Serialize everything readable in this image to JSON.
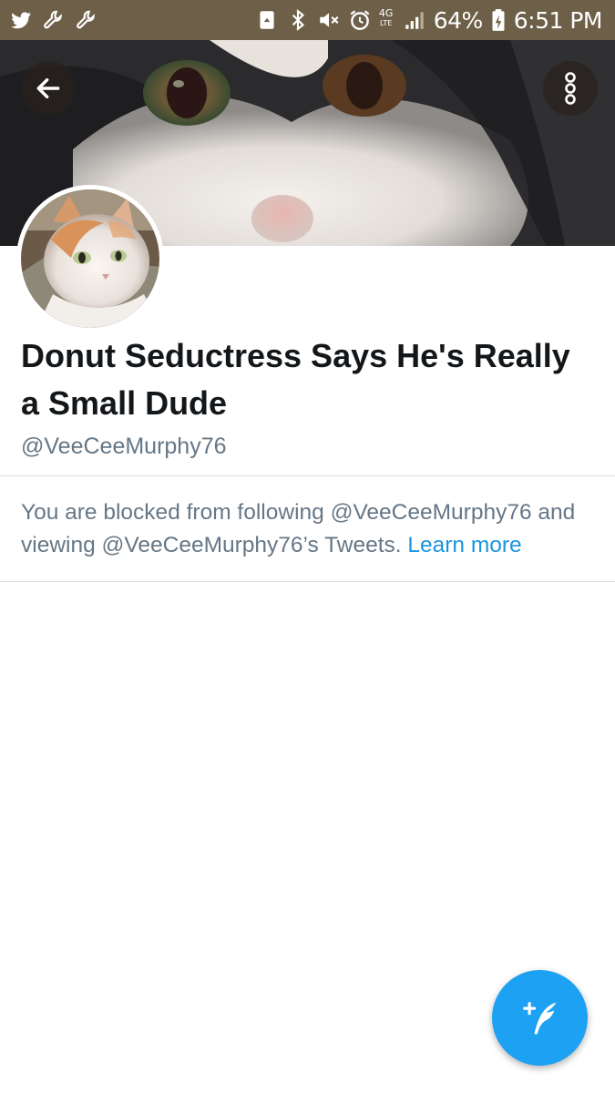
{
  "status_bar": {
    "battery": "64%",
    "time": "6:51 PM",
    "network_top": "4G",
    "network_bottom": "LTE",
    "left_icons": [
      "twitter-bird-icon",
      "wrench-icon",
      "wrench-icon"
    ],
    "right_icons": [
      "recycle-icon",
      "bluetooth-icon",
      "vibrate-mute-icon",
      "alarm-icon",
      "signal-icon",
      "battery-charging-icon"
    ],
    "background_color": "#6e6048"
  },
  "header": {
    "back_icon": "arrow-left-icon",
    "more_icon": "more-vertical-icon"
  },
  "profile": {
    "display_name": "Donut Seductress Says He's Really a Small Dude",
    "handle": "@VeeCeeMurphy76"
  },
  "blocked": {
    "message": "You are blocked from following @VeeCeeMurphy76 and viewing @VeeCeeMurphy76’s Tweets.",
    "link_label": "Learn more",
    "link_color": "#1b95e0"
  },
  "fab": {
    "icon": "compose-tweet-icon",
    "color": "#1da1f2"
  }
}
